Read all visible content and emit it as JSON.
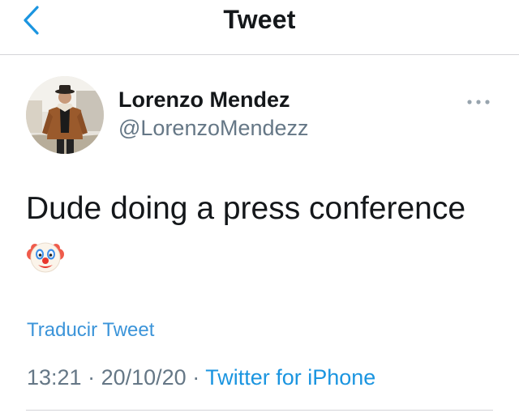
{
  "header": {
    "title": "Tweet",
    "back_icon": "chevron-left-icon"
  },
  "author": {
    "name": "Lorenzo Mendez",
    "handle": "@LorenzoMendezz",
    "avatar": "profile-photo"
  },
  "more_icon": "more-dots-icon",
  "tweet": {
    "text": "Dude doing a press conference",
    "emoji": "clown-face-emoji"
  },
  "translate_label": "Traducir Tweet",
  "meta": {
    "time": "13:21",
    "separator_1": " · ",
    "date": "20/10/20",
    "separator_2": " · ",
    "source": "Twitter for iPhone"
  },
  "colors": {
    "accent": "#1b95e0",
    "text": "#14171a",
    "secondary": "#657786",
    "divider": "#d4d4d8"
  }
}
